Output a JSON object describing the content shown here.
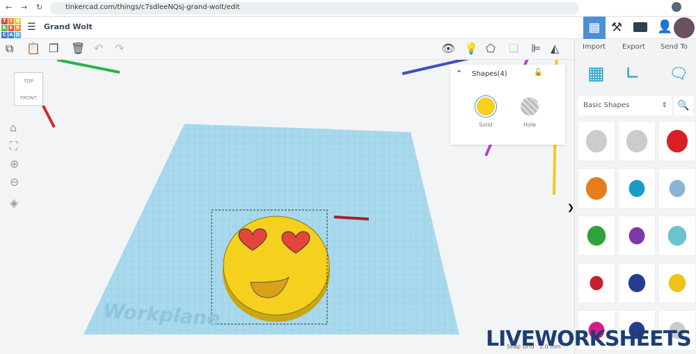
{
  "browser": {
    "url": "tinkercad.com/things/c7sdleeNQsj-grand-wolt/edit"
  },
  "header": {
    "logo_letters": [
      "T",
      "I",
      "N",
      "K",
      "E",
      "R",
      "C",
      "A",
      "D"
    ],
    "title": "Grand Wolt"
  },
  "right_actions": {
    "import": "Import",
    "export": "Export",
    "send_to": "Send To"
  },
  "shapes_panel": {
    "title": "Shapes(4)",
    "solid": "Solid",
    "hole": "Hole"
  },
  "library": {
    "category": "Basic Shapes"
  },
  "viewcube": {
    "top": "TOP",
    "front": "FRONT"
  },
  "workplane": {
    "label": "Workplane"
  },
  "footer": {
    "snap_grid": "Snap Grid",
    "snap_value": "1.0 mm"
  },
  "watermark": {
    "text": "LIVEWORKSHEETS"
  },
  "colors": {
    "accent": "#4a8fd8",
    "solid": "#f5d01e",
    "workplane": "#a9d9ec"
  }
}
